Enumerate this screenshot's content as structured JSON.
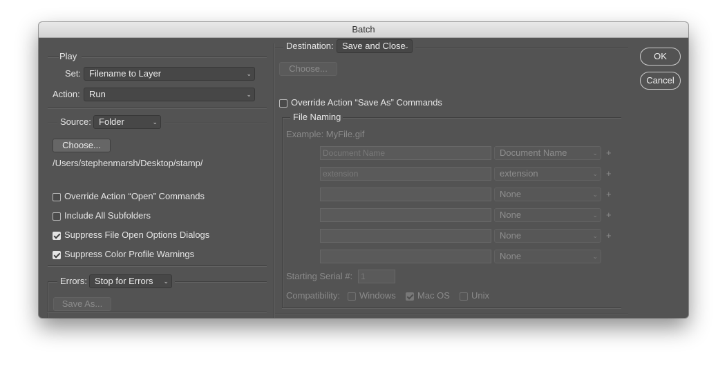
{
  "window": {
    "title": "Batch"
  },
  "play": {
    "legend": "Play",
    "set_label": "Set:",
    "set_value": "Filename to Layer",
    "action_label": "Action:",
    "action_value": "Run"
  },
  "source": {
    "label": "Source:",
    "value": "Folder",
    "choose_label": "Choose...",
    "path": "/Users/stephenmarsh/Desktop/stamp/",
    "options": [
      {
        "label": "Override Action “Open” Commands",
        "checked": false
      },
      {
        "label": "Include All Subfolders",
        "checked": false
      },
      {
        "label": "Suppress File Open Options Dialogs",
        "checked": true
      },
      {
        "label": "Suppress Color Profile Warnings",
        "checked": true
      }
    ]
  },
  "errors": {
    "label": "Errors:",
    "value": "Stop for Errors",
    "save_as_label": "Save As..."
  },
  "destination": {
    "label": "Destination:",
    "value": "Save and Close",
    "choose_label": "Choose...",
    "override_label": "Override Action “Save As” Commands",
    "override_checked": false
  },
  "file_naming": {
    "legend": "File Naming",
    "example": "Example: MyFile.gif",
    "rows": [
      {
        "field_placeholder": "Document Name",
        "select": "Document Name",
        "plus": "+"
      },
      {
        "field_placeholder": "extension",
        "select": "extension",
        "plus": "+"
      },
      {
        "field_placeholder": "",
        "select": "None",
        "plus": "+"
      },
      {
        "field_placeholder": "",
        "select": "None",
        "plus": "+"
      },
      {
        "field_placeholder": "",
        "select": "None",
        "plus": "+"
      },
      {
        "field_placeholder": "",
        "select": "None",
        "plus": ""
      }
    ],
    "serial_label": "Starting Serial #:",
    "serial_value": "1",
    "compat_label": "Compatibility:",
    "compat": [
      {
        "label": "Windows",
        "checked": false
      },
      {
        "label": "Mac OS",
        "checked": true
      },
      {
        "label": "Unix",
        "checked": false
      }
    ]
  },
  "buttons": {
    "ok": "OK",
    "cancel": "Cancel"
  },
  "icons": {
    "dropdown": "chevron-down-icon",
    "checkbox": "checkbox-icon",
    "add": "plus-icon"
  }
}
